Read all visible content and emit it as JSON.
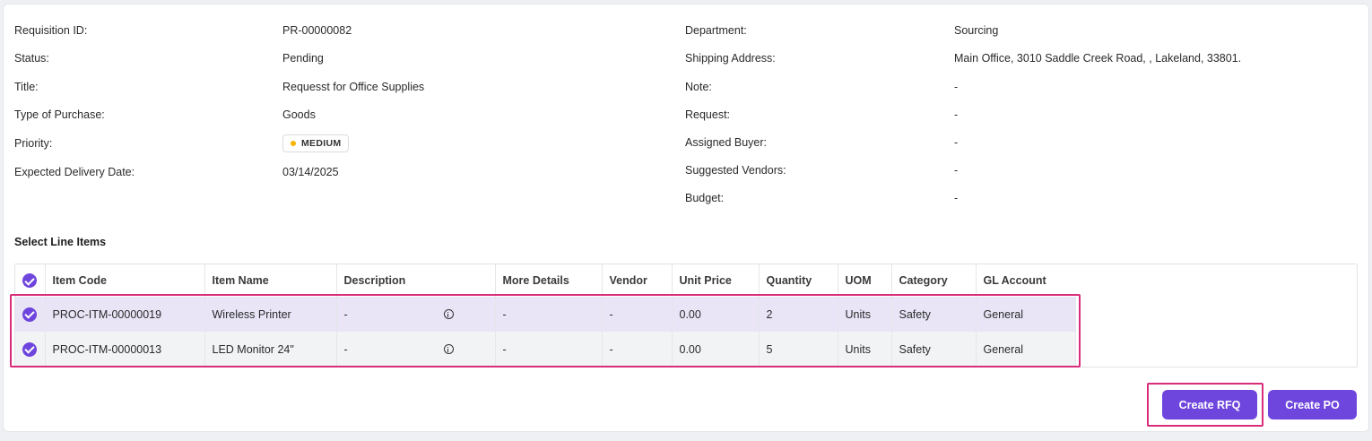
{
  "details_left": [
    {
      "label": "Requisition ID:",
      "value": "PR-00000082"
    },
    {
      "label": "Status:",
      "value": "Pending"
    },
    {
      "label": "Title:",
      "value": "Requesst for Office Supplies"
    },
    {
      "label": "Type of Purchase:",
      "value": "Goods"
    },
    {
      "label": "Priority:",
      "value": "MEDIUM"
    },
    {
      "label": "Expected Delivery Date:",
      "value": "03/14/2025"
    }
  ],
  "details_right": [
    {
      "label": "Department:",
      "value": "Sourcing"
    },
    {
      "label": "Shipping Address:",
      "value": "Main Office, 3010 Saddle Creek Road, , Lakeland, 33801."
    },
    {
      "label": "Note:",
      "value": "-"
    },
    {
      "label": "Request:",
      "value": "-"
    },
    {
      "label": "Assigned Buyer:",
      "value": "-"
    },
    {
      "label": "Suggested Vendors:",
      "value": "-"
    },
    {
      "label": "Budget:",
      "value": "-"
    }
  ],
  "priority_color": "#f5b400",
  "accent_color": "#6f46dd",
  "line_items": {
    "title": "Select Line Items",
    "headers": [
      "Item Code",
      "Item Name",
      "Description",
      "More Details",
      "Vendor",
      "Unit Price",
      "Quantity",
      "UOM",
      "Category",
      "GL Account"
    ],
    "rows": [
      {
        "item_code": "PROC-ITM-00000019",
        "item_name": "Wireless Printer",
        "description": "-",
        "more_details": "-",
        "vendor": "-",
        "unit_price": "0.00",
        "quantity": "2",
        "uom": "Units",
        "category": "Safety",
        "gl_account": "General",
        "checked": true
      },
      {
        "item_code": "PROC-ITM-00000013",
        "item_name": "LED Monitor 24\"",
        "description": "-",
        "more_details": "-",
        "vendor": "-",
        "unit_price": "0.00",
        "quantity": "5",
        "uom": "Units",
        "category": "Safety",
        "gl_account": "General",
        "checked": true
      }
    ]
  },
  "actions": {
    "create_rfq": "Create RFQ",
    "create_po": "Create PO"
  }
}
